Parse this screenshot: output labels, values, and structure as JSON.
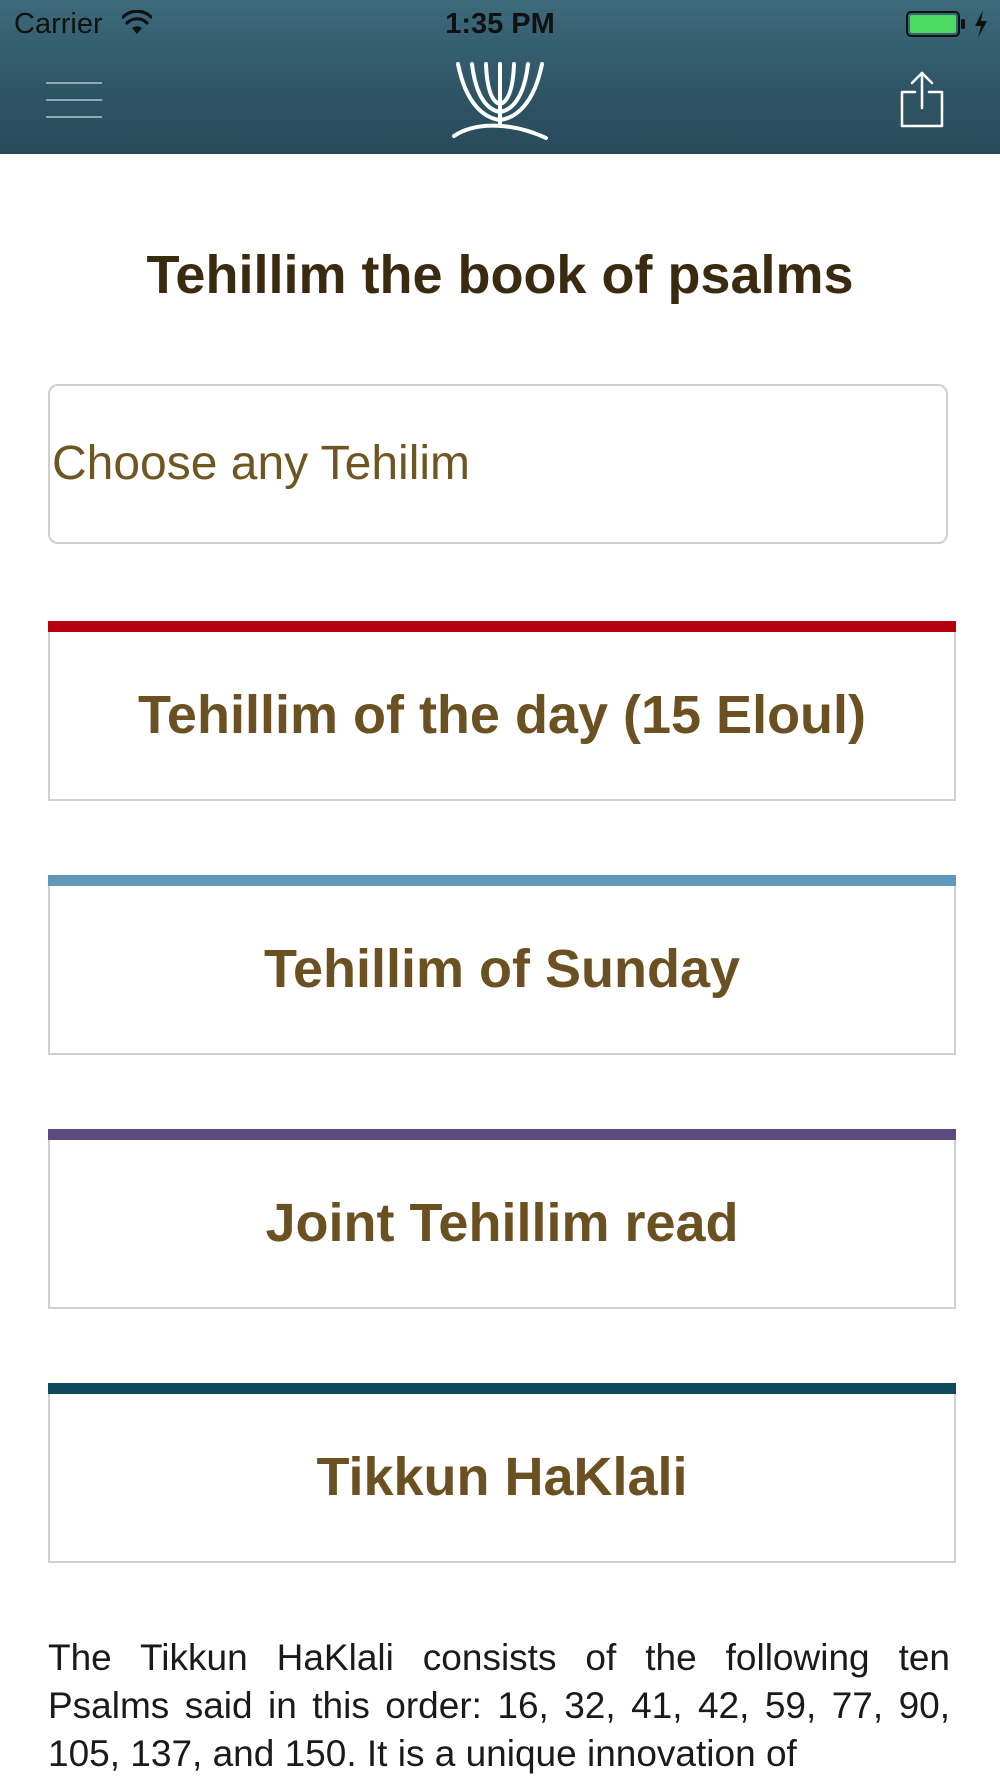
{
  "status_bar": {
    "carrier": "Carrier",
    "time": "1:35 PM"
  },
  "header": {
    "menu_icon": "hamburger-menu-icon",
    "logo_icon": "menorah-logo-icon",
    "share_icon": "share-icon"
  },
  "main": {
    "title": "Tehillim the book of psalms",
    "choose_placeholder": "Choose any Tehilim",
    "cards": [
      {
        "label": "Tehillim of the day (15 Eloul)",
        "accent": "#b5000f"
      },
      {
        "label": "Tehillim of Sunday",
        "accent": "#5f98b8"
      },
      {
        "label": "Joint Tehillim read",
        "accent": "#5c4a7f"
      },
      {
        "label": "Tikkun HaKlali",
        "accent": "#0e4a5c"
      }
    ],
    "description": "The Tikkun HaKlali consists of the following ten Psalms said in this order: 16, 32, 41, 42, 59, 77, 90, 105, 137, and 150. It is a unique innovation of"
  },
  "colors": {
    "header_bg": "#2f5666",
    "title_text": "#3a2a10",
    "card_text": "#6b5122",
    "battery_fill": "#4cd964"
  }
}
